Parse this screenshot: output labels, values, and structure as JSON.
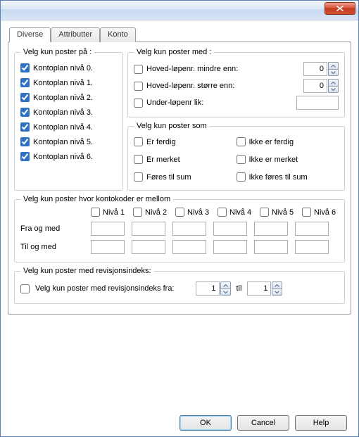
{
  "tabs": {
    "diverse": "Diverse",
    "attributter": "Attributter",
    "konto": "Konto"
  },
  "groups": {
    "paa_legend": "Velg kun poster på :",
    "med_legend": "Velg kun poster med :",
    "som_legend": "Velg kun poster som",
    "kk_legend": "Velg kun poster hvor kontokoder er mellom",
    "rev_legend": "Velg kun poster med revisjonsindeks:"
  },
  "paa_items": [
    "Kontoplan nivå 0.",
    "Kontoplan nivå 1.",
    "Kontoplan nivå 2.",
    "Kontoplan nivå 3.",
    "Kontoplan nivå 4.",
    "Kontoplan nivå 5.",
    "Kontoplan nivå 6."
  ],
  "med": {
    "mindre_label": "Hoved-løpenr. mindre enn:",
    "storre_label": "Hoved-løpenr. større enn:",
    "under_label": "Under-løpenr lik:",
    "mindre_val": "0",
    "storre_val": "0",
    "under_val": ""
  },
  "som": {
    "er_ferdig": "Er ferdig",
    "ikke_er_ferdig": "Ikke er ferdig",
    "er_merket": "Er merket",
    "ikke_er_merket": "Ikke er merket",
    "fores_til_sum": "Føres til sum",
    "ikke_fores_til_sum": "Ikke føres til sum"
  },
  "kk": {
    "nivaa": [
      "Nivå 1",
      "Nivå 2",
      "Nivå 3",
      "Nivå 4",
      "Nivå 5",
      "Nivå 6"
    ],
    "fra_label": "Fra og med",
    "til_label": "Til og med"
  },
  "rev": {
    "chk_label": "Velg kun poster med revisjonsindeks fra:",
    "from_val": "1",
    "til_word": "til",
    "to_val": "1"
  },
  "buttons": {
    "ok": "OK",
    "cancel": "Cancel",
    "help": "Help"
  }
}
